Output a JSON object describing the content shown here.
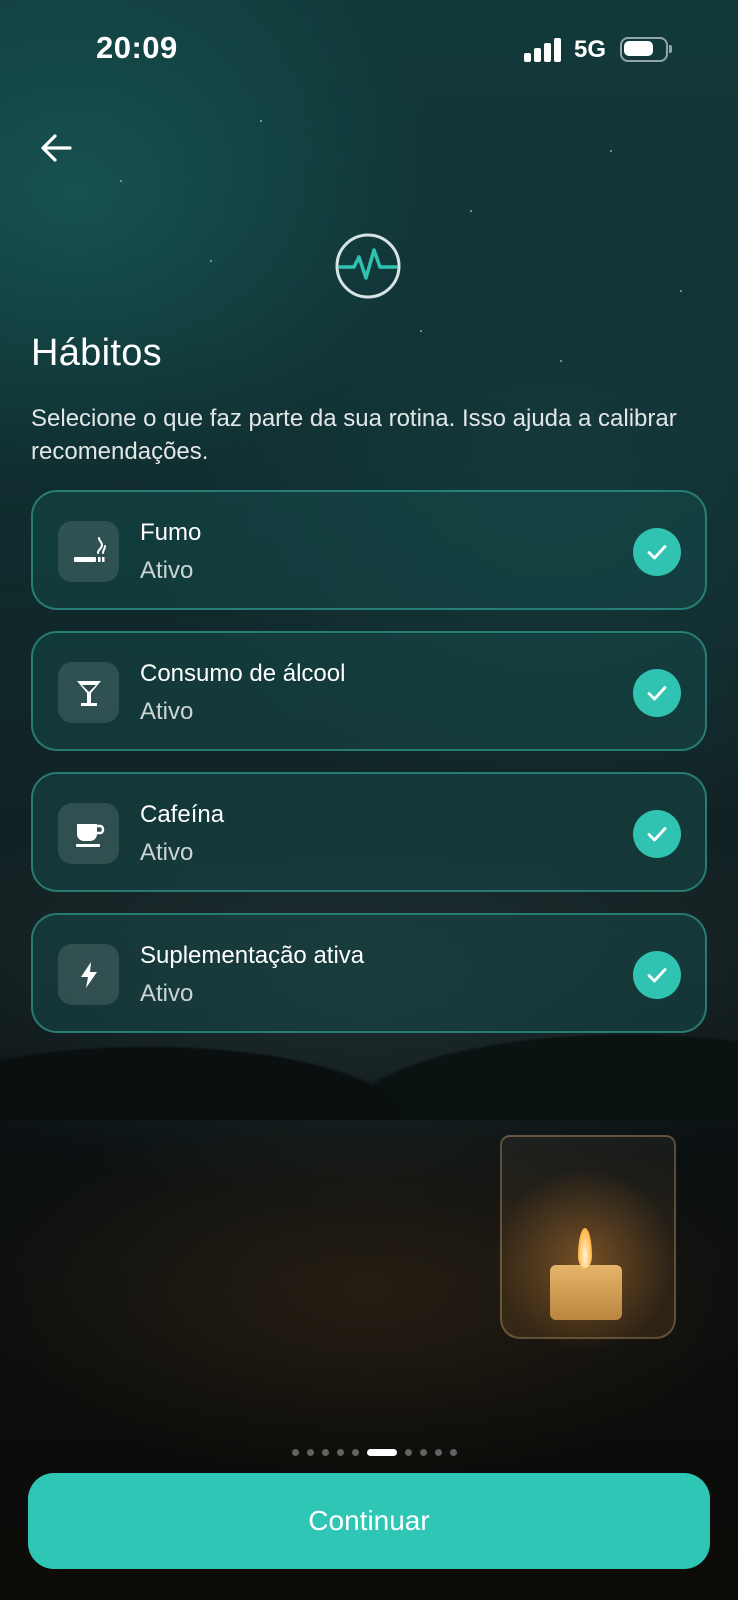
{
  "status_bar": {
    "time": "20:09",
    "network": "5G",
    "signal_bars": 4,
    "battery_level": 0.8
  },
  "header": {
    "back_icon": "arrow-left-icon",
    "logo_icon": "heartbeat-pulse-icon"
  },
  "page": {
    "title": "Hábitos",
    "subtitle": "Selecione o que faz parte da sua rotina. Isso ajuda a calibrar recomendações."
  },
  "habits": [
    {
      "name": "Fumo",
      "status": "Ativo",
      "icon": "smoking-icon",
      "selected": true
    },
    {
      "name": "Consumo de álcool",
      "status": "Ativo",
      "icon": "cocktail-glass-icon",
      "selected": true
    },
    {
      "name": "Cafeína",
      "status": "Ativo",
      "icon": "coffee-cup-icon",
      "selected": true
    },
    {
      "name": "Suplementação ativa",
      "status": "Ativo",
      "icon": "lightning-bolt-icon",
      "selected": true
    }
  ],
  "pager": {
    "total_steps": 10,
    "current_step": 6
  },
  "footer": {
    "continue_label": "Continuar"
  },
  "colors": {
    "accent": "#2fc6b5",
    "card_border": "#38b2a4",
    "card_background": "#164848"
  }
}
